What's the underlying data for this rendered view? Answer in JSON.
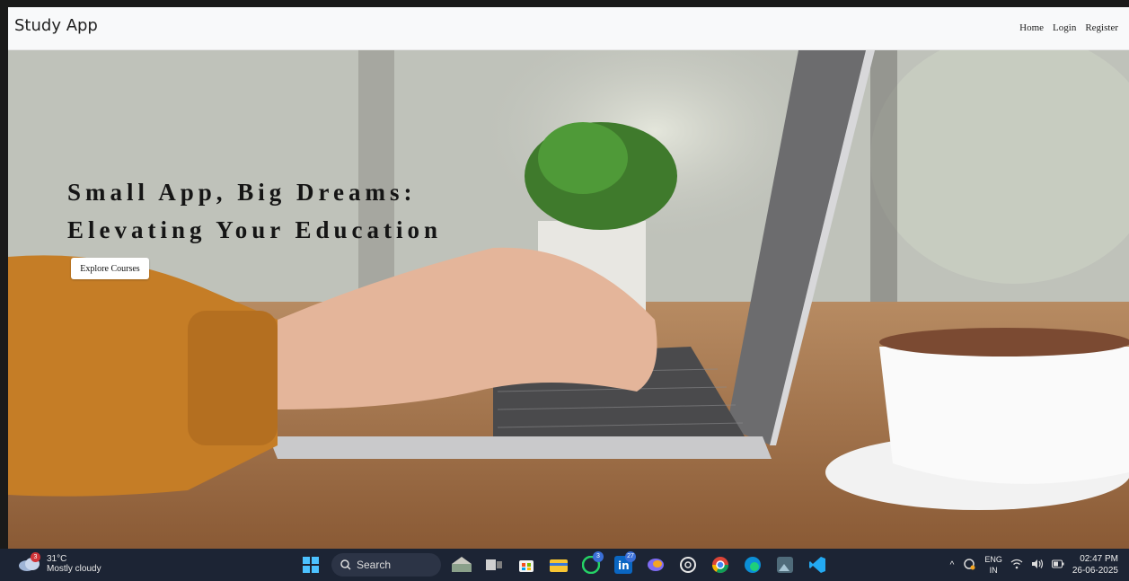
{
  "navbar": {
    "brand": "Study App",
    "links": [
      "Home",
      "Login",
      "Register"
    ]
  },
  "hero": {
    "title_line1": "Small App, Big Dreams:",
    "title_line2": "Elevating Your Education",
    "cta_label": "Explore Courses"
  },
  "taskbar": {
    "weather_temp": "31°C",
    "weather_desc": "Mostly cloudy",
    "weather_badge": "3",
    "search_label": "Search",
    "whatsapp_badge": "3",
    "linkedin_badge": "27",
    "lang_line1": "ENG",
    "lang_line2": "IN",
    "time": "02:47 PM",
    "date": "26-06-2025"
  },
  "colors": {
    "navbar_bg": "#f8f9fa",
    "taskbar_bg": "#1c2434",
    "title_color": "#151515"
  }
}
